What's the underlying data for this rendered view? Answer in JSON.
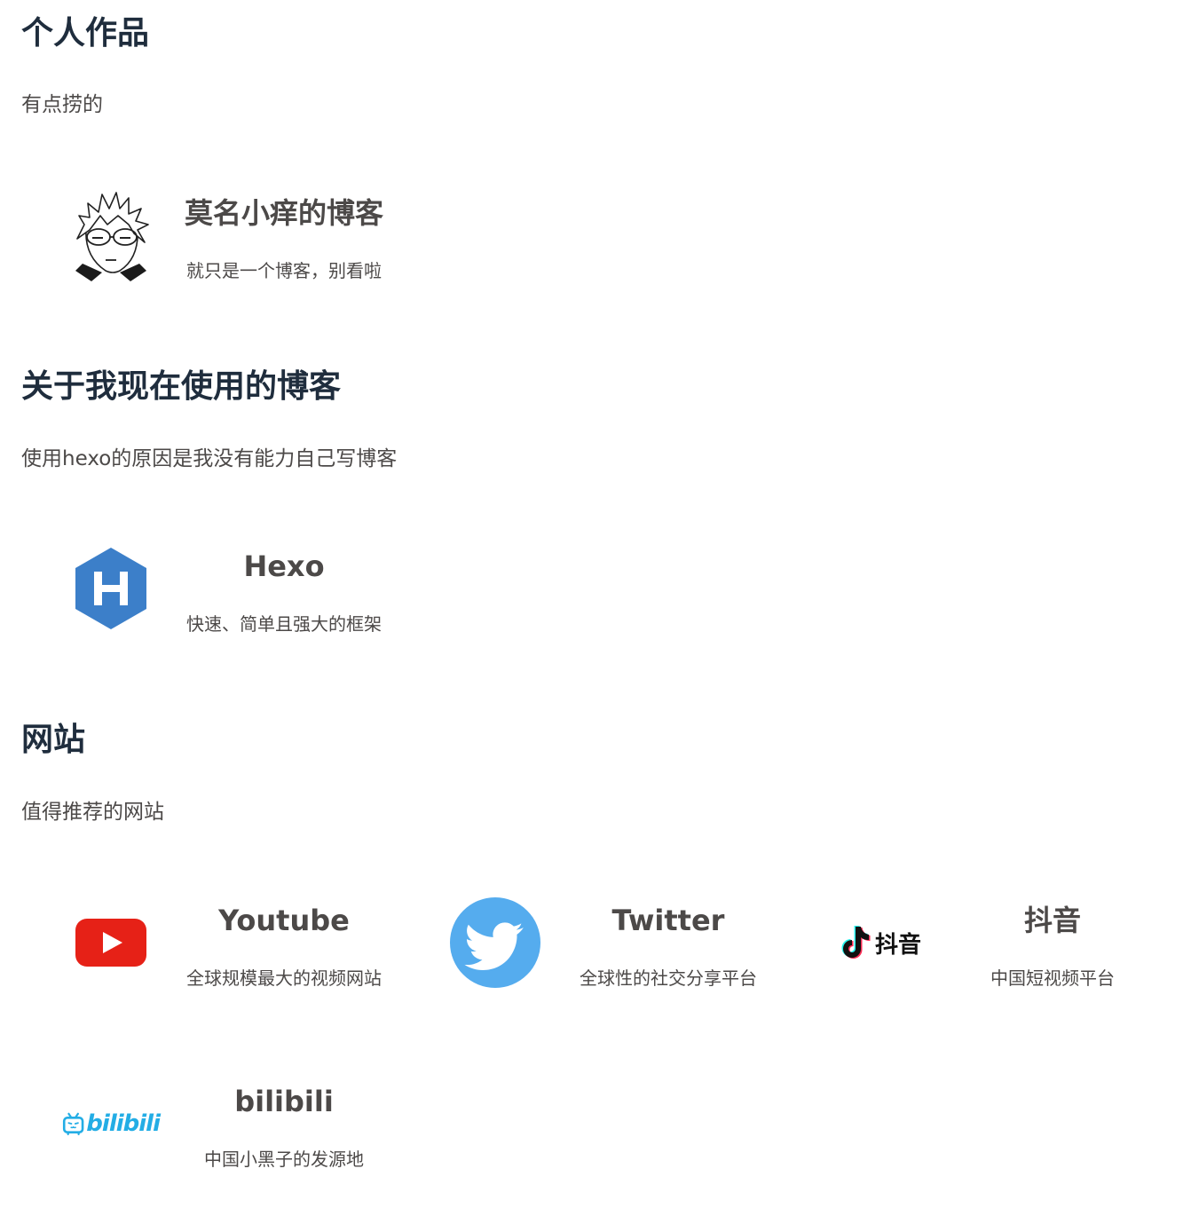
{
  "sections": [
    {
      "title": "个人作品",
      "description": "有点捞的",
      "cards": [
        {
          "name": "莫名小痒的博客",
          "description": "就只是一个博客，别看啦",
          "icon": "anime-avatar-icon"
        }
      ]
    },
    {
      "title": "关于我现在使用的博客",
      "description": "使用hexo的原因是我没有能力自己写博客",
      "cards": [
        {
          "name": "Hexo",
          "description": "快速、简单且强大的框架",
          "icon": "hexo-logo-icon"
        }
      ]
    },
    {
      "title": "网站",
      "description": "值得推荐的网站",
      "cards": [
        {
          "name": "Youtube",
          "description": "全球规模最大的视频网站",
          "icon": "youtube-logo-icon"
        },
        {
          "name": "Twitter",
          "description": "全球性的社交分享平台",
          "icon": "twitter-logo-icon"
        },
        {
          "name": "抖音",
          "description": "中国短视频平台",
          "icon": "douyin-logo-icon",
          "logo_text": "抖音"
        },
        {
          "name": "bilibili",
          "description": "中国小黑子的发源地",
          "icon": "bilibili-logo-icon",
          "logo_text": "bilibili"
        }
      ]
    }
  ],
  "colors": {
    "heading": "#1f2d3d",
    "text": "#4c4948",
    "hexo": "#3c7fc9",
    "youtube": "#e62117",
    "twitter": "#55acee",
    "bilibili": "#23ade5"
  }
}
